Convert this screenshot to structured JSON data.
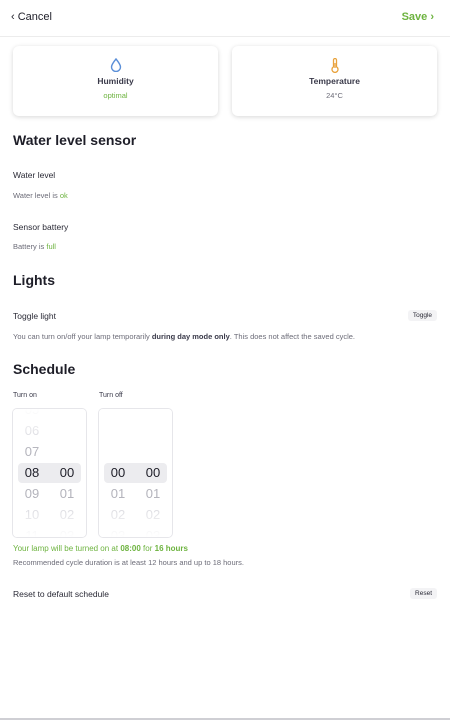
{
  "header": {
    "cancel_label": "‹ Cancel",
    "save_label": "Save ›"
  },
  "cards": {
    "humidity": {
      "title": "Humidity",
      "value": "optimal",
      "value_color": "#6db33f",
      "icon": "water-drop-icon",
      "icon_color": "#5b8fd8"
    },
    "temperature": {
      "title": "Temperature",
      "value": "24°C",
      "value_color": "#6c6c78",
      "icon": "thermometer-icon",
      "icon_color": "#e8a23c"
    }
  },
  "water_sensor": {
    "heading": "Water level sensor",
    "level_label": "Water level",
    "level_text": "Water level is",
    "level_value": "ok",
    "battery_label": "Sensor battery",
    "battery_text": "Battery is",
    "battery_value": "full"
  },
  "lights": {
    "heading": "Lights",
    "toggle_label": "Toggle light",
    "toggle_button": "Toggle",
    "note_before": "You can turn on/off your lamp temporarily",
    "note_bold": "during day mode only",
    "note_after": ". This does not affect the saved cycle."
  },
  "schedule": {
    "heading": "Schedule",
    "turn_on_label": "Turn on",
    "turn_off_label": "Turn off",
    "turn_on_hours": [
      "05",
      "06",
      "07",
      "08",
      "09",
      "10",
      "11"
    ],
    "turn_on_minutes": [
      "",
      "",
      "",
      "00",
      "01",
      "02",
      "03"
    ],
    "turn_off_hours": [
      "",
      "",
      "",
      "00",
      "01",
      "02",
      "03"
    ],
    "turn_off_minutes": [
      "",
      "",
      "",
      "00",
      "01",
      "02",
      "03"
    ],
    "summary_prefix": "Your lamp will be turned on at",
    "summary_time": "08:00",
    "summary_mid": "for",
    "summary_duration": "16 hours",
    "recommendation": "Recommended cycle duration is at least 12 hours and up to 18 hours.",
    "reset_label": "Reset to default schedule",
    "reset_button": "Reset"
  },
  "colors": {
    "accent": "#6db33f",
    "text": "#1e1e28",
    "muted": "#6c6c78"
  }
}
